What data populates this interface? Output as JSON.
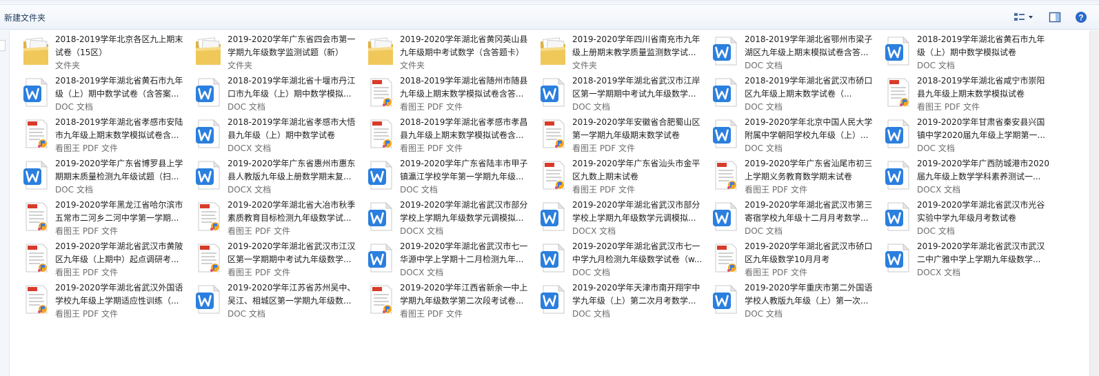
{
  "toolbar": {
    "new_folder_label": "新建文件夹",
    "view_icon": "view-options-icon",
    "pane_icon": "preview-pane-icon",
    "help_icon": "help-icon"
  },
  "icon_colors": {
    "folder": "#f0c85a",
    "doc": "#2b7fde",
    "pdf": "#d93b2b"
  },
  "files": [
    {
      "name": "2018-2019学年北京各区九上期末试卷（15区）",
      "type": "文件夹",
      "kind": "folder"
    },
    {
      "name": "2019-2020学年广东省四会市第一学期九年级数学监测试题（新）",
      "type": "文件夹",
      "kind": "folder"
    },
    {
      "name": "2019-2020学年湖北省黄冈英山县九年级期中考试数学（含答题卡）",
      "type": "文件夹",
      "kind": "folder"
    },
    {
      "name": "2019-2020学年四川省南充市九年级上册期末教学质量监测数学试...",
      "type": "文件夹",
      "kind": "folder"
    },
    {
      "name": "2018-2019学年湖北省鄂州市梁子湖区九年级上期末模拟试卷含答...",
      "type": "DOC 文档",
      "kind": "doc"
    },
    {
      "name": "2018-2019学年湖北省黄石市九年级（上）期中数学模拟试卷",
      "type": "DOC 文档",
      "kind": "doc"
    },
    {
      "name": "2018-2019学年湖北省黄石市九年级（上）期中数学试卷（含答案...",
      "type": "DOC 文档",
      "kind": "doc"
    },
    {
      "name": "2018-2019学年湖北省十堰市丹江口市九年级（上）期中数学模拟...",
      "type": "DOC 文档",
      "kind": "doc"
    },
    {
      "name": "2018-2019学年湖北省随州市随县九年级上期末数学模拟试卷含答...",
      "type": "看图王 PDF 文件",
      "kind": "pdf"
    },
    {
      "name": "2018-2019学年湖北省武汉市江岸区第一学期期中考试九年级数学...",
      "type": "DOC 文档",
      "kind": "doc"
    },
    {
      "name": "2018-2019学年湖北省武汉市硚口区九年级上期末数学试卷（...",
      "type": "DOC 文档",
      "kind": "doc"
    },
    {
      "name": "2018-2019学年湖北省咸宁市崇阳县九年级上期末数学模拟试卷",
      "type": "看图王 PDF 文件",
      "kind": "pdf"
    },
    {
      "name": "2018-2019学年湖北省孝感市安陆市九年级上期末数学模拟试卷含...",
      "type": "看图王 PDF 文件",
      "kind": "pdf"
    },
    {
      "name": "2018-2019学年湖北省孝感市大悟县九年级（上）期中数学试卷",
      "type": "DOCX 文档",
      "kind": "doc"
    },
    {
      "name": "2018-2019学年湖北省孝感市孝昌县九年级上期末数学模拟试卷含...",
      "type": "看图王 PDF 文件",
      "kind": "pdf"
    },
    {
      "name": "2019-2020学年安徽省合肥蜀山区第一学期九年级期末数学试卷",
      "type": "看图王 PDF 文件",
      "kind": "pdf"
    },
    {
      "name": "2019-2020学年北京中国人民大学附属中学朝阳学校九年级（上）...",
      "type": "DOC 文档",
      "kind": "doc"
    },
    {
      "name": "2019-2020学年甘肃省秦安县兴国镇中学2020届九年级上学期第一...",
      "type": "DOC 文档",
      "kind": "doc"
    },
    {
      "name": "2019-2020学年广东省博罗县上学期期末质量检测九年级试题（扫...",
      "type": "DOC 文档",
      "kind": "doc"
    },
    {
      "name": "2019-2020学年广东省惠州市惠东县人教版九年级上册数学期末复...",
      "type": "DOCX 文档",
      "kind": "doc"
    },
    {
      "name": "2019-2020学年广东省陆丰市甲子镇瀛江学校学年第一学期九年级...",
      "type": "DOC 文档",
      "kind": "doc"
    },
    {
      "name": "2019-2020学年广东省汕头市金平区九数上期末试卷",
      "type": "看图王 PDF 文件",
      "kind": "pdf"
    },
    {
      "name": "2019-2020学年广东省汕尾市初三上学期义务教育数学期末试卷",
      "type": "看图王 PDF 文件",
      "kind": "pdf"
    },
    {
      "name": "2019-2020学年广西防城港市2020届九年级上数学学科素养测试一...",
      "type": "DOCX 文档",
      "kind": "doc"
    },
    {
      "name": "2019-2020学年黑龙江省哈尔滨市五常市二河乡二河中学第一学期...",
      "type": "看图王 PDF 文件",
      "kind": "pdf"
    },
    {
      "name": "2019-2020学年湖北省大冶市秋季素质教育目标检测九年级数学试...",
      "type": "看图王 PDF 文件",
      "kind": "pdf"
    },
    {
      "name": "2019-2020学年湖北省武汉市部分学校上学期九年级数学元调模拟...",
      "type": "DOCX 文档",
      "kind": "doc"
    },
    {
      "name": "2019-2020学年湖北省武汉市部分学校上学期九年级数学元调模拟...",
      "type": "DOCX 文档",
      "kind": "doc"
    },
    {
      "name": "2019-2020学年湖北省武汉市第三寄宿学校九年级十二月月考数学...",
      "type": "DOC 文档",
      "kind": "doc"
    },
    {
      "name": "2019-2020学年湖北省武汉市光谷实验中学九年级月考数试卷",
      "type": "DOC 文档",
      "kind": "doc"
    },
    {
      "name": "2019-2020学年湖北省武汉市黄陂区九年级（上期中）起点调研考...",
      "type": "看图王 PDF 文件",
      "kind": "pdf"
    },
    {
      "name": "2019-2020学年湖北省武汉市江汉区第一学期期中考试九年级数学...",
      "type": "看图王 PDF 文件",
      "kind": "pdf"
    },
    {
      "name": "2019-2020学年湖北省武汉市七一华源中学上学期十二月检测九年...",
      "type": "DOCX 文档",
      "kind": "doc"
    },
    {
      "name": "2019-2020学年湖北省武汉市七一中学九月检测九年级数学试卷（w...",
      "type": "DOC 文档",
      "kind": "doc"
    },
    {
      "name": "2019-2020学年湖北省武汉市硚口区九年级数学10月月考",
      "type": "看图王 PDF 文件",
      "kind": "pdf"
    },
    {
      "name": "2019-2020学年湖北省武汉市武汉二中广雅中学上学期九年级数学...",
      "type": "DOCX 文档",
      "kind": "doc"
    },
    {
      "name": "2019-2020学年湖北省武汉外国语学校九年级上学期适应性训练（...",
      "type": "看图王 PDF 文件",
      "kind": "pdf"
    },
    {
      "name": "2019-2020学年江苏省苏州吴中、吴江、相城区第一学期九年级数...",
      "type": "DOC 文档",
      "kind": "doc"
    },
    {
      "name": "2019-2020学年江西省新余一中上学期九年级数学第二次段考试卷...",
      "type": "看图王 PDF 文件",
      "kind": "pdf"
    },
    {
      "name": "2019-2020学年天津市南开翔宇中学九年级（上）第二次月考数学...",
      "type": "DOC 文档",
      "kind": "doc"
    },
    {
      "name": "2019-2020学年重庆市第二外国语学校人教版九年级（上）第一次...",
      "type": "DOC 文档",
      "kind": "doc"
    }
  ]
}
